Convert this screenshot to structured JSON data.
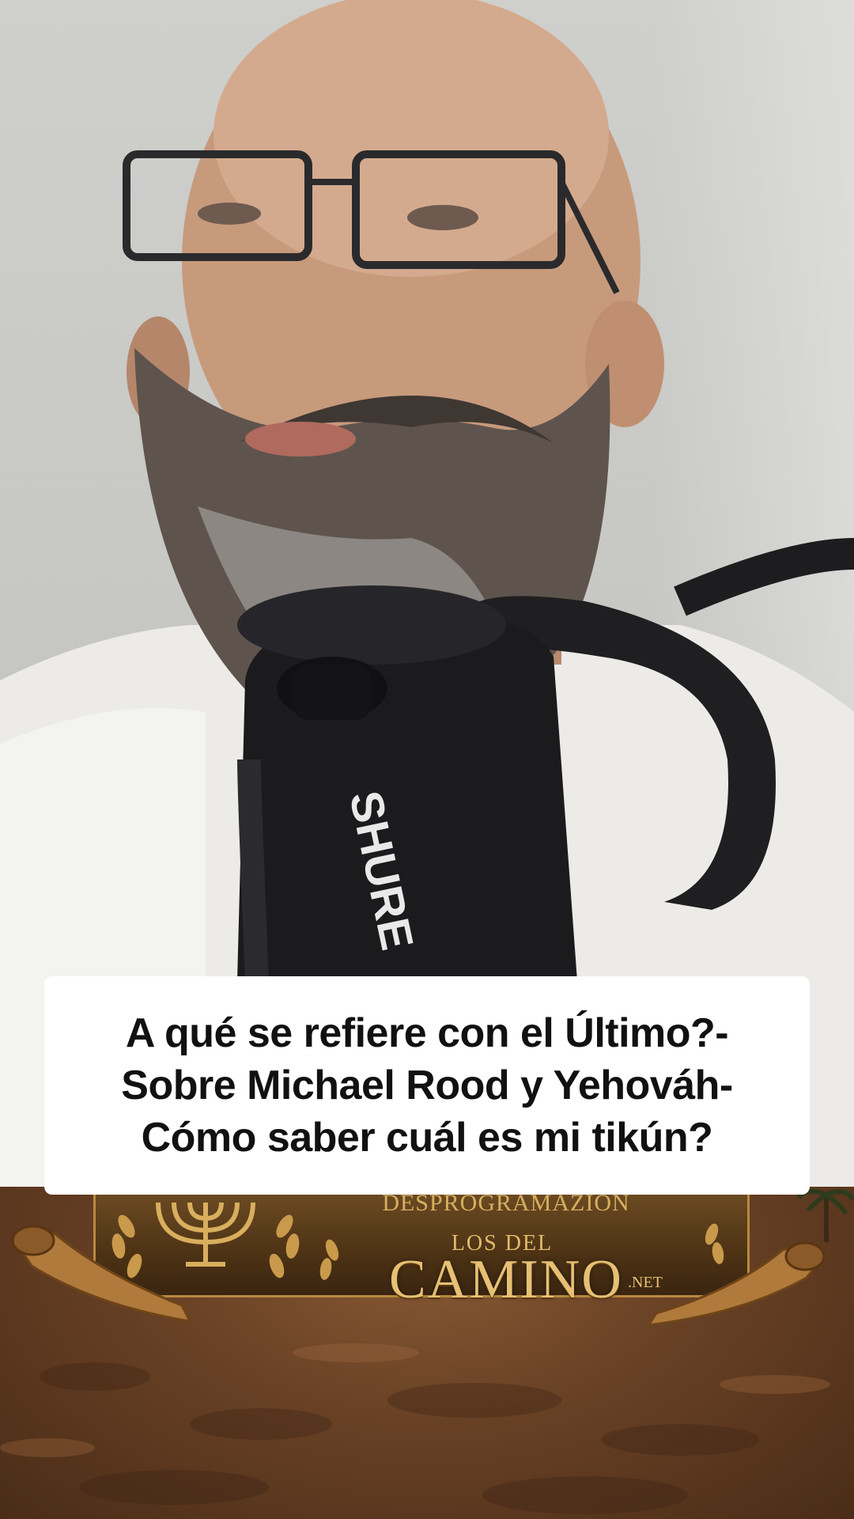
{
  "caption": {
    "lines": [
      "A qué se refiere con el Último?-",
      "Sobre Michael Rood y Yehováh-",
      "Cómo saber cuál es mi tikún?"
    ]
  },
  "microphone": {
    "brand": "SHURE"
  },
  "logo": {
    "subtitle": "DESPROGRAMAZION",
    "small": "LOS DEL",
    "main": "CAMINO",
    "tld": ".NET"
  },
  "colors": {
    "caption_bg": "#ffffff",
    "caption_text": "#111111",
    "logo_gold": "#e6c074",
    "ground": "#6b4326"
  },
  "icons": [
    "menorah-icon",
    "shofar-icon",
    "laurel-icon",
    "palm-tree-icon"
  ]
}
